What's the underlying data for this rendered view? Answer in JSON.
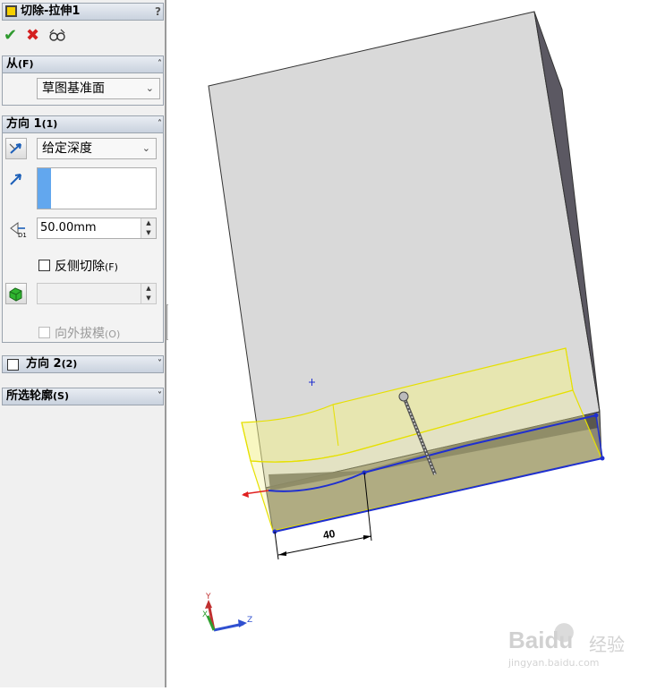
{
  "panel": {
    "title": "切除-拉伸1",
    "help": "?",
    "from": {
      "label": "从",
      "key": "(F)",
      "selected": "草图基准面"
    },
    "direction1": {
      "label": "方向 1",
      "key": "(1)",
      "end_condition": "给定深度",
      "depth": "50.00mm",
      "flip_side_label": "反侧切除",
      "flip_side_key": "(F)",
      "draft_outward_label": "向外拔模",
      "draft_outward_key": "(O)"
    },
    "direction2": {
      "label": "方向 2",
      "key": "(2)"
    },
    "selected_contours": {
      "label": "所选轮廓",
      "key": "(S)"
    }
  },
  "view": {
    "dimension": "40",
    "triad": {
      "x": "X",
      "y": "Y",
      "z": "Z"
    },
    "watermark": {
      "brand": "Baidu",
      "suffix": "经验",
      "url": "jingyan.baidu.com"
    }
  },
  "colors": {
    "accept": "#2f9a2f",
    "cancel": "#d42020",
    "sketch": "#1f2fd0",
    "preview": "#f2ee55"
  }
}
